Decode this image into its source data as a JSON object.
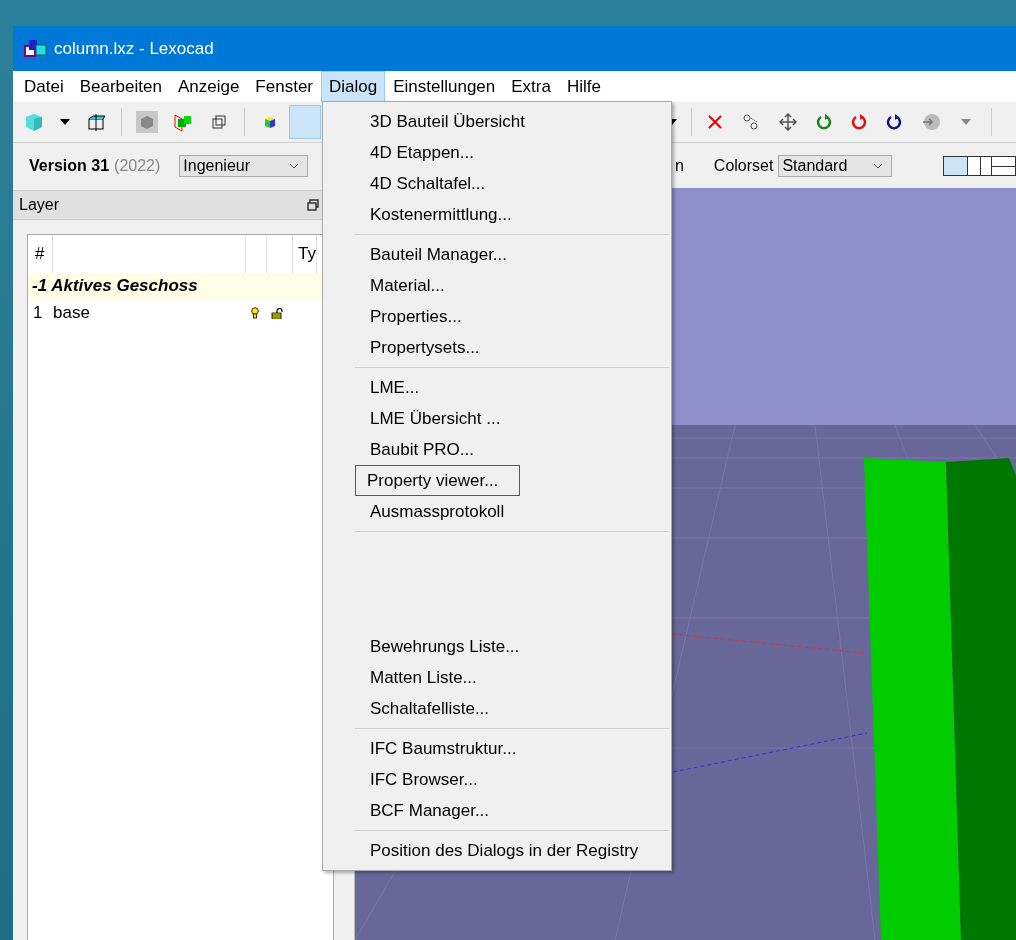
{
  "window": {
    "title": "column.lxz - Lexocad"
  },
  "menubar": [
    {
      "label": "Datei",
      "selected": false
    },
    {
      "label": "Bearbeiten",
      "selected": false
    },
    {
      "label": "Anzeige",
      "selected": false
    },
    {
      "label": "Fenster",
      "selected": false
    },
    {
      "label": "Dialog",
      "selected": true
    },
    {
      "label": "Einstellungen",
      "selected": false
    },
    {
      "label": "Extra",
      "selected": false
    },
    {
      "label": "Hilfe",
      "selected": false
    }
  ],
  "options": {
    "version": "Version 31",
    "year": "(2022)",
    "profile": "Ingenieur",
    "hidden_label": "n",
    "colorset_label": "Colorset",
    "colorset": "Standard"
  },
  "layer_panel": {
    "title": "Layer",
    "number_heading": "#",
    "type_heading": "Ty",
    "groups": [
      {
        "label": "-1 Aktives Geschoss",
        "layers": [
          {
            "number": "1",
            "name": "base",
            "visible": true,
            "locked": false
          }
        ]
      }
    ]
  },
  "dialog_menu": {
    "items": [
      {
        "kind": "item",
        "label": "3D Bauteil Übersicht",
        "highlighted": false
      },
      {
        "kind": "item",
        "label": "4D  Etappen...",
        "highlighted": false
      },
      {
        "kind": "item",
        "label": "4D Schaltafel...",
        "highlighted": false
      },
      {
        "kind": "item",
        "label": "Kostenermittlung...",
        "highlighted": false
      },
      {
        "kind": "separator"
      },
      {
        "kind": "item",
        "label": "Bauteil Manager...",
        "highlighted": false
      },
      {
        "kind": "item",
        "label": "Material...",
        "highlighted": false
      },
      {
        "kind": "item",
        "label": "Properties...",
        "highlighted": false
      },
      {
        "kind": "item",
        "label": "Propertysets...",
        "highlighted": false
      },
      {
        "kind": "separator"
      },
      {
        "kind": "item",
        "label": "LME...",
        "highlighted": false
      },
      {
        "kind": "item",
        "label": "LME Übersicht ...",
        "highlighted": false
      },
      {
        "kind": "item",
        "label": "Baubit PRO...",
        "highlighted": false
      },
      {
        "kind": "item",
        "label": "Property viewer...",
        "highlighted": true
      },
      {
        "kind": "item",
        "label": "Ausmassprotokoll",
        "highlighted": false
      },
      {
        "kind": "separator"
      },
      {
        "kind": "gap"
      },
      {
        "kind": "item",
        "label": "Bewehrungs Liste...",
        "highlighted": false
      },
      {
        "kind": "item",
        "label": "Matten Liste...",
        "highlighted": false
      },
      {
        "kind": "item",
        "label": "Schaltafelliste...",
        "highlighted": false
      },
      {
        "kind": "separator"
      },
      {
        "kind": "item",
        "label": "IFC Baumstruktur...",
        "highlighted": false
      },
      {
        "kind": "item",
        "label": "IFC Browser...",
        "highlighted": false
      },
      {
        "kind": "item",
        "label": "BCF Manager...",
        "highlighted": false
      },
      {
        "kind": "separator"
      },
      {
        "kind": "item",
        "label": "Position des Dialogs in der Registry",
        "highlighted": false
      }
    ]
  }
}
